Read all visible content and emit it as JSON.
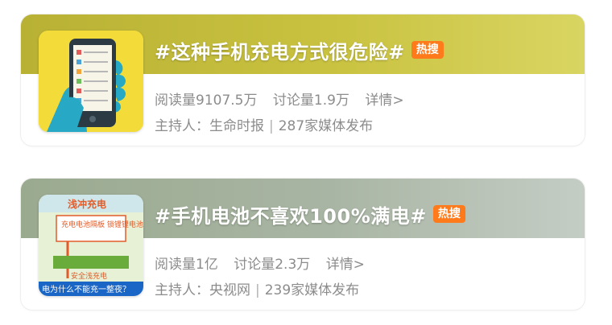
{
  "topics": [
    {
      "title": "#这种手机充电方式很危险#",
      "badge": "热搜",
      "reads": "阅读量9107.5万",
      "discussions": "讨论量1.9万",
      "details": "详情>",
      "host_label": "主持人：",
      "host_name": "生命时报",
      "media": "287家媒体发布"
    },
    {
      "title": "#手机电池不喜欢100%满电#",
      "badge": "热搜",
      "reads": "阅读量1亿",
      "discussions": "讨论量2.3万",
      "details": "详情>",
      "host_label": "主持人：",
      "host_name": "央视网",
      "media": "239家媒体发布",
      "thumb_text": {
        "heading": "浅冲充电",
        "box": "充电电池隔板 锁锂锂电池安全",
        "label": "安全浅充电",
        "caption": "电为什么不能充一整夜？"
      }
    }
  ],
  "colors": {
    "hot_badge": "#ff7a1a",
    "card1_header": "#c2bb3a",
    "card2_header": "#a9b5a4",
    "meta_text": "#8c8c8c"
  }
}
